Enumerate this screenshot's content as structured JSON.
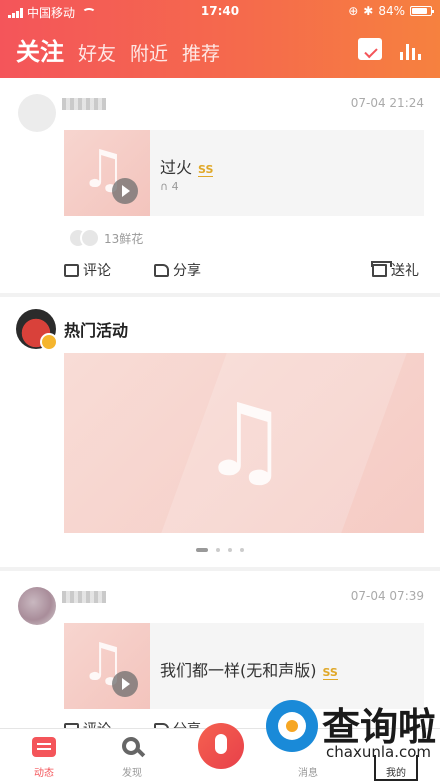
{
  "status_bar": {
    "carrier": "中国移动",
    "time": "17:40",
    "battery": "84%"
  },
  "header": {
    "tabs": [
      {
        "label": "关注",
        "active": true
      },
      {
        "label": "好友",
        "active": false
      },
      {
        "label": "附近",
        "active": false
      },
      {
        "label": "推荐",
        "active": false
      }
    ],
    "icons": [
      "calendar-check-icon",
      "bar-chart-icon"
    ]
  },
  "colors": {
    "accent": "#f4555a",
    "header_end": "#f6813f",
    "quality_badge": "#e0a829"
  },
  "feed": {
    "post1": {
      "date": "07-04 21:24",
      "song_title": "过火",
      "quality": "SS",
      "listens": "4",
      "flowers": "13鲜花",
      "actions": {
        "comment": "评论",
        "share": "分享",
        "gift": "送礼"
      }
    },
    "activity": {
      "title": "热门活动",
      "pager_count": 4,
      "pager_active": 0
    },
    "post2": {
      "date": "07-04 07:39",
      "song_title": "我们都一样(无和声版)",
      "quality": "SS",
      "actions": {
        "comment": "评论",
        "share": "分享"
      }
    }
  },
  "bottom_nav": [
    {
      "label": "动态",
      "active": true
    },
    {
      "label": "发现",
      "active": false
    },
    {
      "label": "",
      "active": false
    },
    {
      "label": "消息",
      "active": false
    },
    {
      "label": "我的",
      "active": false
    }
  ],
  "watermark": {
    "title": "查询啦",
    "domain": "chaxunla.com"
  }
}
